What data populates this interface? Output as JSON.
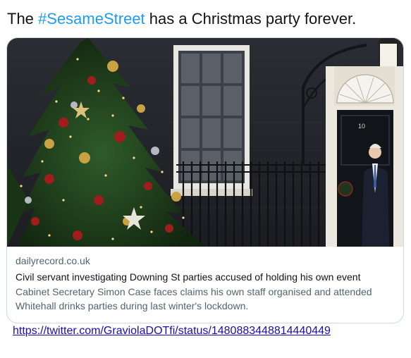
{
  "tweet": {
    "text_before": "The ",
    "hashtag": "#SesameStreet",
    "text_after": " has a Christmas party forever."
  },
  "card": {
    "domain": "dailyrecord.co.uk",
    "headline": "Civil servant investigating Downing St parties accused of holding his own event",
    "description": "Cabinet Secretary Simon Case faces claims his own staff organised and attended Whitehall drinks parties during last winter's lockdown.",
    "image": {
      "door_number": "10"
    }
  },
  "footer_link": {
    "text": "https://twitter.com/GraviolaDOTfi/status/1480883448814440449"
  }
}
